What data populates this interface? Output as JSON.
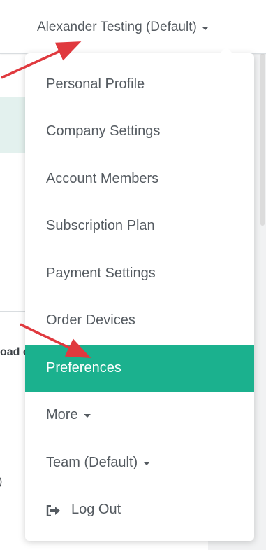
{
  "header": {
    "account_label": "Alexander Testing (Default)"
  },
  "background": {
    "bold_fragment": "oad c",
    "paren_fragment": ")"
  },
  "menu": {
    "items": [
      {
        "label": "Personal Profile"
      },
      {
        "label": "Company Settings"
      },
      {
        "label": "Account Members"
      },
      {
        "label": "Subscription Plan"
      },
      {
        "label": "Payment Settings"
      },
      {
        "label": "Order Devices"
      },
      {
        "label": "Preferences",
        "active": true
      },
      {
        "label": "More"
      },
      {
        "label": "Team (Default)"
      },
      {
        "label": "Log Out"
      }
    ]
  },
  "colors": {
    "accent": "#1bb18e",
    "text": "#555b61",
    "annotation_arrow": "#e0393e"
  },
  "icons": {
    "dropdown_caret": "chevron-down-icon",
    "log_out": "sign-out-icon"
  }
}
